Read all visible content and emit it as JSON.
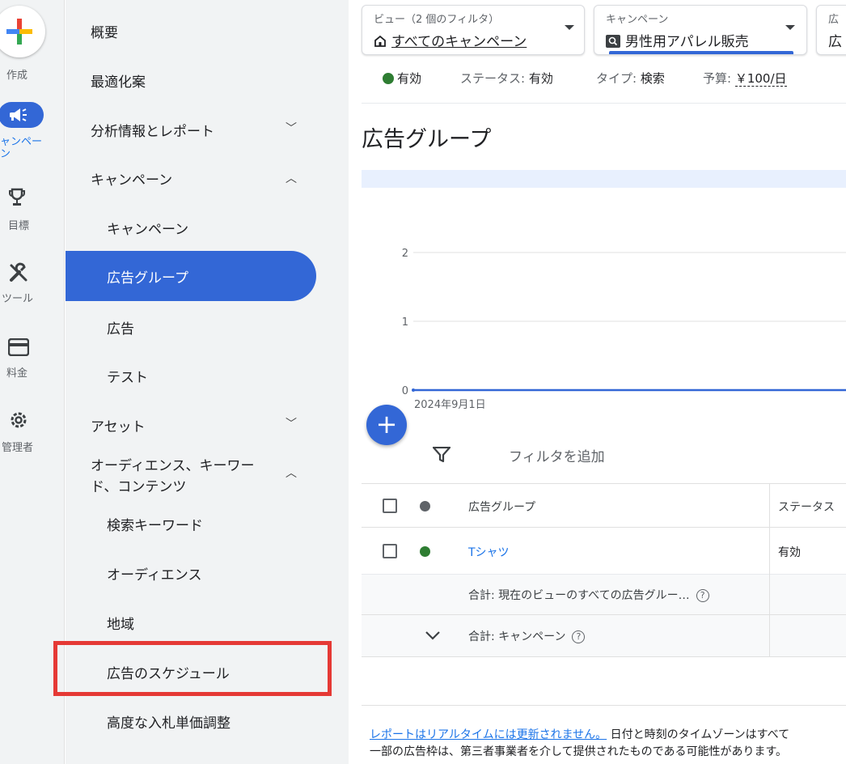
{
  "rail": {
    "create_label": "作成",
    "campaign_label": "ャンペーン",
    "goals_label": "目標",
    "tools_label": "ツール",
    "billing_label": "料金",
    "admin_label": "管理者"
  },
  "nav": {
    "overview": "概要",
    "recommendations": "最適化案",
    "insights": "分析情報とレポート",
    "campaigns_section": "キャンペーン",
    "campaigns": "キャンペーン",
    "ad_groups": "広告グループ",
    "ads": "広告",
    "experiments": "テスト",
    "assets": "アセット",
    "audiences_line1": "オーディエンス、キーワー",
    "audiences_line2": "ド、コンテンツ",
    "search_keywords": "検索キーワード",
    "audiences": "オーディエンス",
    "locations": "地域",
    "ad_schedule": "広告のスケジュール",
    "advanced_bid": "高度な入札単価調整"
  },
  "header": {
    "view_label": "ビュー（2 個のフィルタ）",
    "view_value": "すべてのキャンペーン",
    "campaign_label": "キャンペーン",
    "campaign_value": "男性用アパレル販売",
    "third_label": "広",
    "third_value": "広"
  },
  "status": {
    "enabled": "有効",
    "status_label": "ステータス: ",
    "status_value": "有効",
    "type_label": "タイプ: ",
    "type_value": "検索",
    "budget_label": "予算: ",
    "budget_value": "￥100/日"
  },
  "page_title": "広告グループ",
  "chart_data": {
    "type": "line",
    "x": [
      "2024年9月1日"
    ],
    "series": [
      {
        "values": [
          0
        ]
      }
    ],
    "ylim": [
      0,
      2
    ],
    "yticks": [
      "0",
      "1",
      "2"
    ],
    "xlabel": "",
    "ylabel": "",
    "grid": true
  },
  "table": {
    "filter_label": "フィルタを追加",
    "col_name": "広告グループ",
    "col_status": "ステータス",
    "rows": [
      {
        "name": "Tシャツ",
        "status": "有効"
      }
    ],
    "total_view": "合計: 現在のビューのすべての広告グルー…",
    "total_campaign": "合計: キャンペーン"
  },
  "footer": {
    "link": "レポートはリアルタイムには更新されません。",
    "text1": " 日付と時刻のタイムゾーンはすべて",
    "text2": "一部の広告枠は、第三者事業者を介して提供されたものである可能性があります。"
  },
  "colors": {
    "accent": "#3367d6",
    "link": "#1a73e8",
    "enabled_green": "#2e7d32",
    "highlight_red": "#e53935"
  }
}
